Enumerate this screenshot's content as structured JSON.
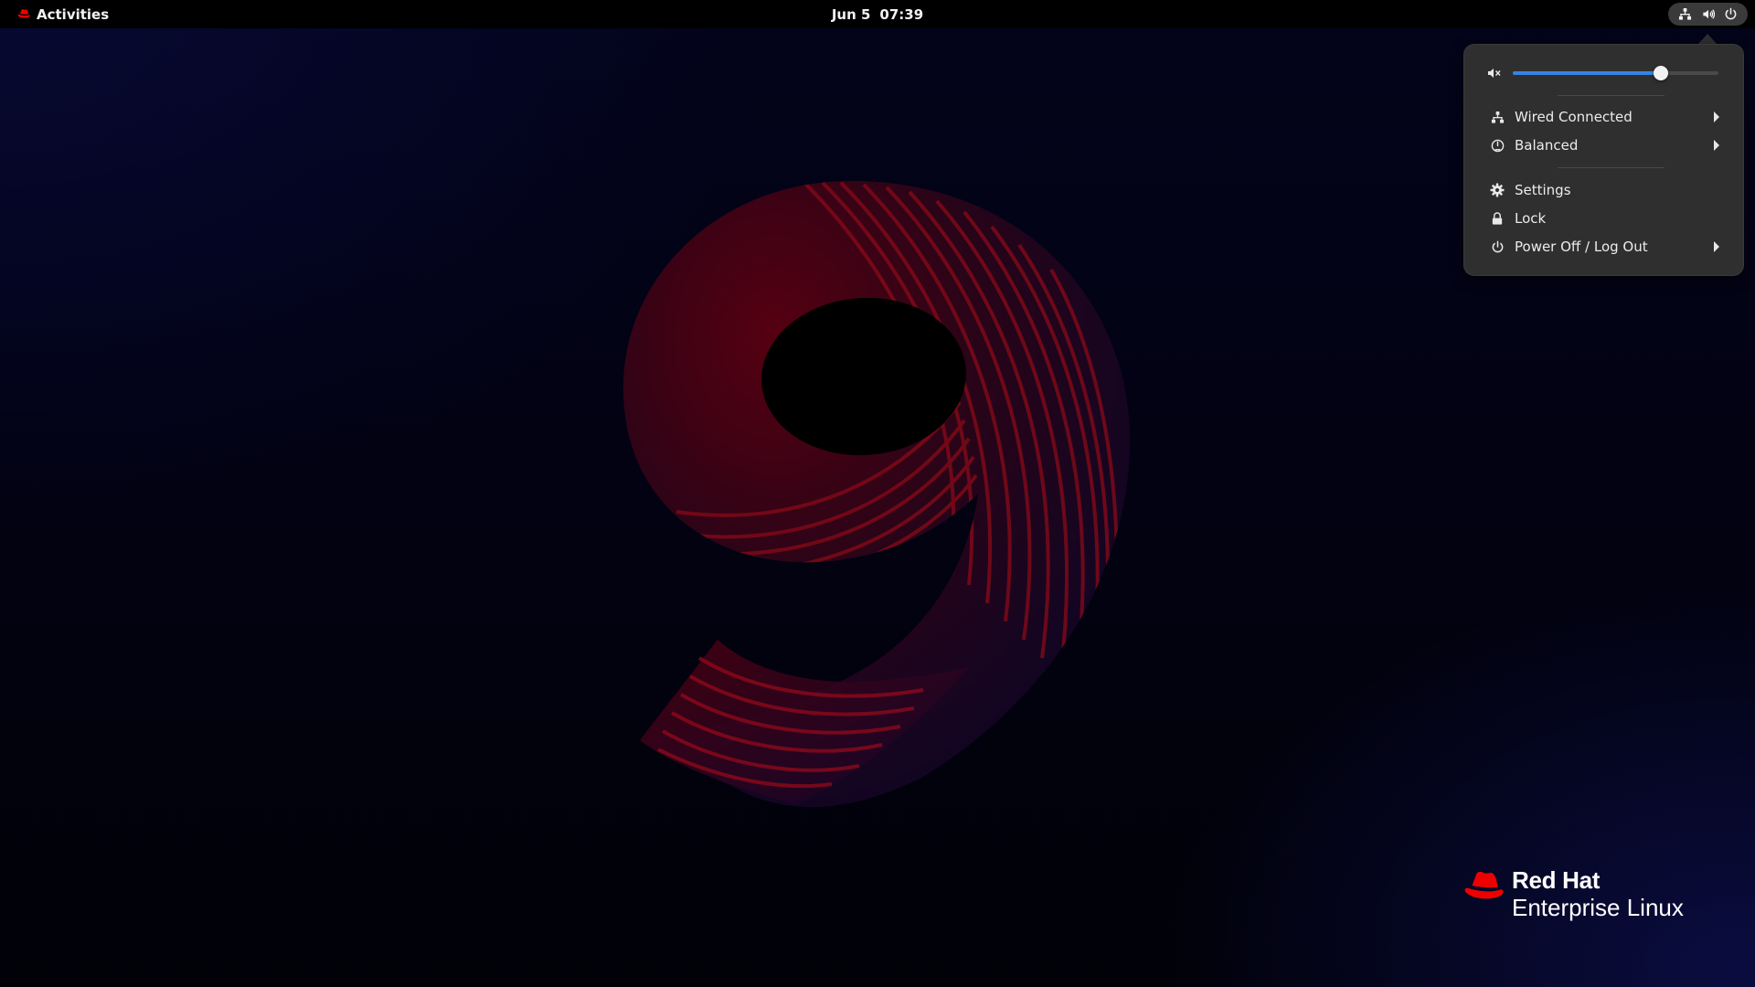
{
  "topbar": {
    "activities_label": "Activities",
    "date": "Jun 5",
    "time": "07:39"
  },
  "tray": {
    "icons": [
      "network-wired-icon",
      "volume-icon",
      "power-icon"
    ]
  },
  "menu": {
    "volume": {
      "icon": "volume-muted-icon",
      "level_fraction": 0.72
    },
    "items": [
      {
        "label": "Wired Connected",
        "icon": "network-wired-icon",
        "has_submenu": true
      },
      {
        "label": "Balanced",
        "icon": "power-profile-icon",
        "has_submenu": true
      },
      {
        "label": "Settings",
        "icon": "gear-icon",
        "has_submenu": false
      },
      {
        "label": "Lock",
        "icon": "lock-icon",
        "has_submenu": false
      },
      {
        "label": "Power Off / Log Out",
        "icon": "power-icon",
        "has_submenu": true
      }
    ]
  },
  "branding": {
    "line1": "Red Hat",
    "line2": "Enterprise Linux"
  },
  "colors": {
    "accent": "#3584e4",
    "brand_red": "#ee0000",
    "menu_bg": "#2f2f2f",
    "topbar_bg": "#000000"
  }
}
